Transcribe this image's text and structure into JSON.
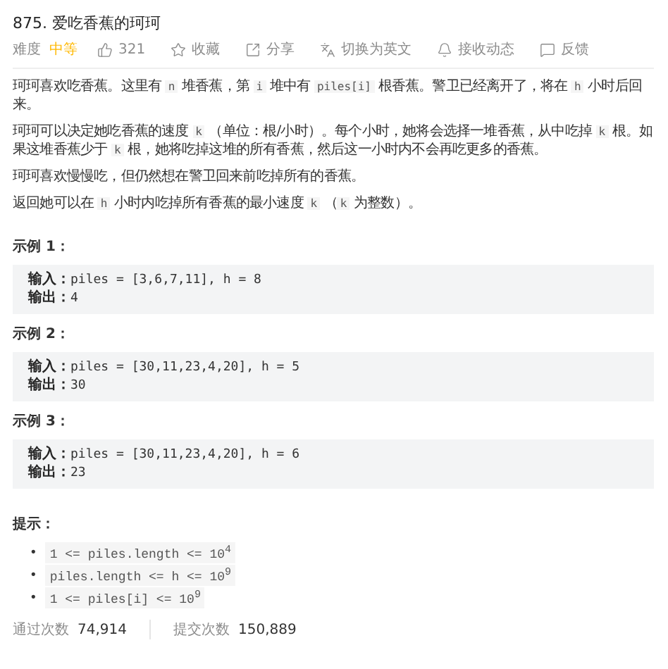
{
  "title": "875. 爱吃香蕉的珂珂",
  "meta": {
    "difficulty_label": "难度",
    "difficulty": {
      "text": "中等",
      "color": "#ffb800"
    },
    "actions": [
      {
        "kind": "like",
        "label": "321"
      },
      {
        "kind": "star",
        "label": "收藏"
      },
      {
        "kind": "share",
        "label": "分享"
      },
      {
        "kind": "translate",
        "label": "切换为英文"
      },
      {
        "kind": "bell",
        "label": "接收动态"
      },
      {
        "kind": "feedback",
        "label": "反馈"
      }
    ]
  },
  "paragraphs": [
    [
      {
        "kind": "text",
        "text": "珂珂喜欢吃香蕉。这里有 "
      },
      {
        "kind": "code",
        "text": "n"
      },
      {
        "kind": "text",
        "text": " 堆香蕉，第 "
      },
      {
        "kind": "code",
        "text": "i"
      },
      {
        "kind": "text",
        "text": " 堆中有 "
      },
      {
        "kind": "code",
        "text": "piles[i]"
      },
      {
        "kind": "text",
        "text": " 根香蕉。警卫已经离开了，将在 "
      },
      {
        "kind": "code",
        "text": "h"
      },
      {
        "kind": "text",
        "text": " 小时后回来。"
      }
    ],
    [
      {
        "kind": "text",
        "text": "珂珂可以决定她吃香蕉的速度 "
      },
      {
        "kind": "code",
        "text": "k"
      },
      {
        "kind": "text",
        "text": " （单位：根/小时）。每个小时，她将会选择一堆香蕉，从中吃掉 "
      },
      {
        "kind": "code",
        "text": "k"
      },
      {
        "kind": "text",
        "text": " 根。如果这堆香蕉少于 "
      },
      {
        "kind": "code",
        "text": "k"
      },
      {
        "kind": "text",
        "text": " 根，她将吃掉这堆的所有香蕉，然后这一小时内不会再吃更多的香蕉。"
      }
    ],
    [
      {
        "kind": "text",
        "text": "珂珂喜欢慢慢吃，但仍然想在警卫回来前吃掉所有的香蕉。"
      }
    ],
    [
      {
        "kind": "text",
        "text": "返回她可以在 "
      },
      {
        "kind": "code",
        "text": "h"
      },
      {
        "kind": "text",
        "text": " 小时内吃掉所有香蕉的最小速度 "
      },
      {
        "kind": "code",
        "text": "k"
      },
      {
        "kind": "text",
        "text": " （"
      },
      {
        "kind": "code",
        "text": "k"
      },
      {
        "kind": "text",
        "text": " 为整数）。"
      }
    ]
  ],
  "examples": [
    {
      "heading": "示例 1：",
      "lines": [
        {
          "label": "输入：",
          "value": "piles = [3,6,7,11], h = 8"
        },
        {
          "label": "输出：",
          "value": "4"
        }
      ]
    },
    {
      "heading": "示例 2：",
      "lines": [
        {
          "label": "输入：",
          "value": "piles = [30,11,23,4,20], h = 5"
        },
        {
          "label": "输出：",
          "value": "30"
        }
      ]
    },
    {
      "heading": "示例 3：",
      "lines": [
        {
          "label": "输入：",
          "value": "piles = [30,11,23,4,20], h = 6"
        },
        {
          "label": "输出：",
          "value": "23"
        }
      ]
    }
  ],
  "hints": {
    "heading": "提示：",
    "items": [
      {
        "bullet": "•",
        "text": "1 <= piles.length <= 10$^{4}$"
      },
      {
        "bullet": "•",
        "text": "piles.length <= h <= 10$^{9}$"
      },
      {
        "bullet": "•",
        "text": "1 <= piles[i] <= 10$^{9}$"
      }
    ]
  },
  "stats": [
    {
      "label": "通过次数",
      "value": "74,914"
    },
    {
      "label": "提交次数",
      "value": "150,889"
    }
  ]
}
